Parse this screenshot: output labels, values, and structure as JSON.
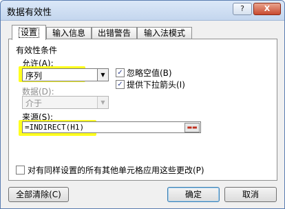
{
  "window": {
    "title": "数据有效性",
    "help_label": "?",
    "close_label": "X"
  },
  "tabs": [
    {
      "label": "设置",
      "active": true
    },
    {
      "label": "输入信息",
      "active": false
    },
    {
      "label": "出错警告",
      "active": false
    },
    {
      "label": "输入法模式",
      "active": false
    }
  ],
  "settings": {
    "section_title": "有效性条件",
    "allow_label": "允许(A):",
    "allow_value": "序列",
    "ignore_blank_label": "忽略空值(B)",
    "ignore_blank_checked": true,
    "dropdown_label": "提供下拉箭头(I)",
    "dropdown_checked": true,
    "data_label": "数据(D):",
    "data_value": "介于",
    "source_label": "来源(S):",
    "source_value": "=INDIRECT(H1)",
    "apply_all_label": "对有同样设置的所有其他单元格应用这些更改(P)",
    "apply_all_checked": false
  },
  "buttons": {
    "clear_all": "全部清除(C)",
    "ok": "确定",
    "cancel": "取消"
  },
  "icons": {
    "ref_selector": "range-select-icon",
    "dropdown": "chevron-down-icon",
    "check": "check-icon"
  },
  "colors": {
    "highlight": "#ffff00"
  }
}
